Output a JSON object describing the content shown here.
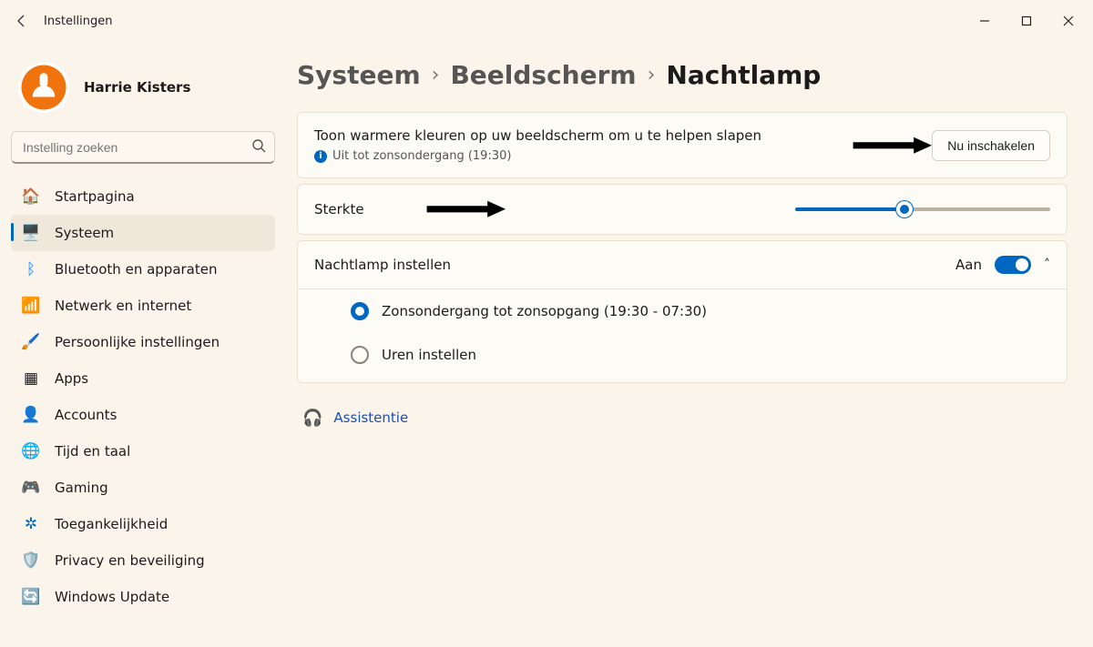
{
  "window": {
    "title": "Instellingen"
  },
  "profile": {
    "name": "Harrie Kisters"
  },
  "search": {
    "placeholder": "Instelling zoeken"
  },
  "sidebar": {
    "items": [
      {
        "label": "Startpagina"
      },
      {
        "label": "Systeem"
      },
      {
        "label": "Bluetooth en apparaten"
      },
      {
        "label": "Netwerk en internet"
      },
      {
        "label": "Persoonlijke instellingen"
      },
      {
        "label": "Apps"
      },
      {
        "label": "Accounts"
      },
      {
        "label": "Tijd en taal"
      },
      {
        "label": "Gaming"
      },
      {
        "label": "Toegankelijkheid"
      },
      {
        "label": "Privacy en beveiliging"
      },
      {
        "label": "Windows Update"
      }
    ],
    "active_index": 1
  },
  "breadcrumb": {
    "p1": "Systeem",
    "p2": "Beeldscherm",
    "p3": "Nachtlamp"
  },
  "cards": {
    "intro": {
      "title": "Toon warmere kleuren op uw beeldscherm om u te helpen slapen",
      "sub": "Uit tot zonsondergang (19:30)",
      "action": "Nu inschakelen"
    },
    "strength": {
      "label": "Sterkte",
      "value_percent": 43
    },
    "schedule": {
      "header": "Nachtlamp instellen",
      "state": "Aan",
      "options": [
        {
          "label": "Zonsondergang tot zonsopgang (19:30 - 07:30)",
          "selected": true
        },
        {
          "label": "Uren instellen",
          "selected": false
        }
      ]
    }
  },
  "assist": {
    "label": "Assistentie"
  }
}
